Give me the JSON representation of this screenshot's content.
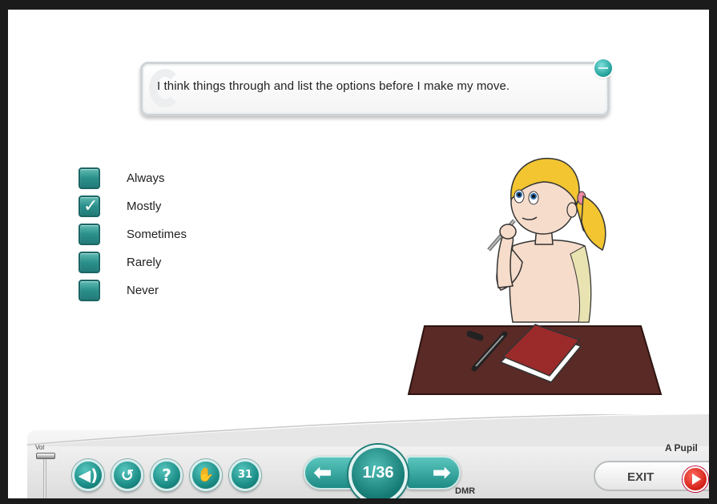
{
  "question": {
    "text": "I think things through and list the options before I make my move."
  },
  "options": [
    {
      "label": "Always",
      "checked": false
    },
    {
      "label": "Mostly",
      "checked": true
    },
    {
      "label": "Sometimes",
      "checked": false
    },
    {
      "label": "Rarely",
      "checked": false
    },
    {
      "label": "Never",
      "checked": false
    }
  ],
  "toolbar": {
    "volume_label": "Vol",
    "navigation": {
      "page_indicator": "1/36",
      "prev_icon": "arrow-left-icon",
      "next_icon": "arrow-right-icon"
    },
    "buttons": [
      {
        "icon": "speaker-icon",
        "glyph": "🔊"
      },
      {
        "icon": "replay-icon",
        "glyph": "↺"
      },
      {
        "icon": "help-icon",
        "glyph": "?"
      },
      {
        "icon": "hand-icon",
        "glyph": "✋"
      },
      {
        "icon": "calendar-icon",
        "glyph": "31"
      }
    ],
    "dmr_label": "DMR",
    "pupil_name": "A Pupil",
    "exit_label": "EXIT"
  },
  "colors": {
    "accent_teal": "#1c8f88",
    "exit_red": "#d21f17",
    "desk": "#5a2a27",
    "book": "#9b2a2a"
  }
}
